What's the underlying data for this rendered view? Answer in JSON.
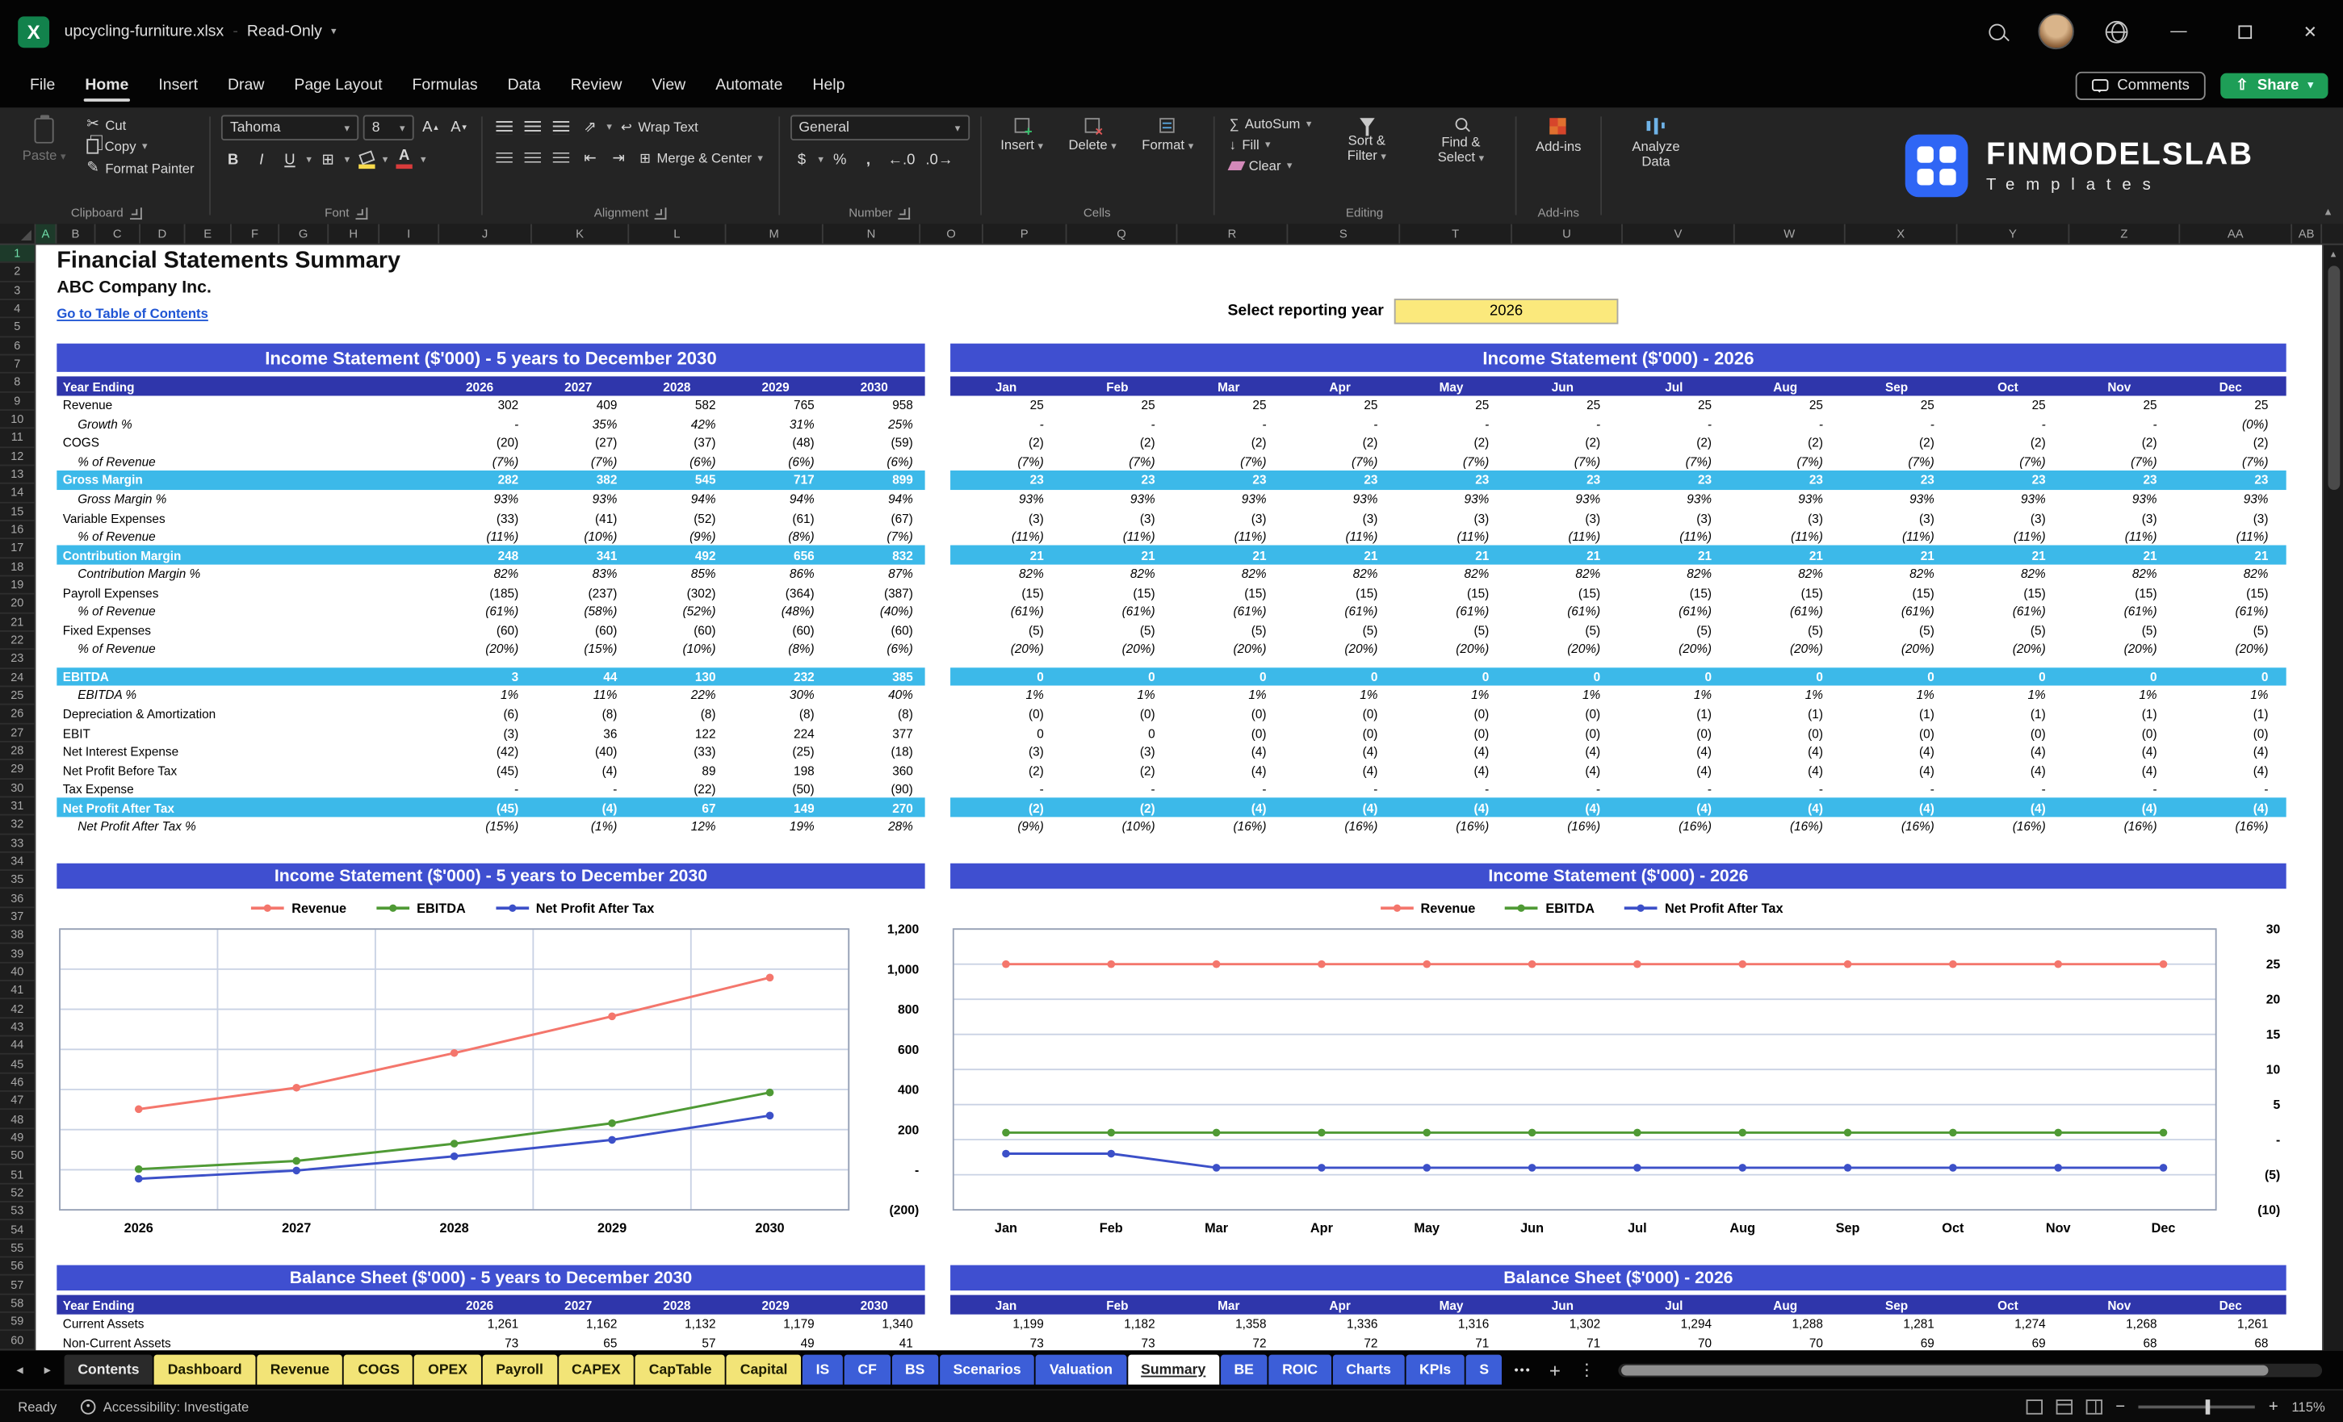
{
  "colors": {
    "header_blue": "#3F4FD0",
    "subheader_blue": "#2F36AB",
    "band_cyan": "#3CB9E9",
    "highlight_yellow": "#FBE97C",
    "tab_yellow": "#F2E477",
    "tab_blue": "#3C5ED8",
    "excel_green": "#12824C",
    "share_green": "#1E9E57",
    "link_blue": "#1F55D4",
    "fill_swatch": "#F7D94C",
    "font_swatch": "#D83B3B"
  },
  "titlebar": {
    "filename": "upcycling-furniture.xlsx",
    "separator": "-",
    "mode": "Read-Only"
  },
  "menu": {
    "items": [
      "File",
      "Home",
      "Insert",
      "Draw",
      "Page Layout",
      "Formulas",
      "Data",
      "Review",
      "View",
      "Automate",
      "Help"
    ],
    "active": "Home",
    "comments_label": "Comments",
    "share_label": "Share"
  },
  "ribbon": {
    "paste": "Paste",
    "cut": "Cut",
    "copy": "Copy",
    "format_painter": "Format Painter",
    "font_name": "Tahoma",
    "font_size": "8",
    "wrap_text": "Wrap Text",
    "merge_center": "Merge & Center",
    "number_format": "General",
    "insert": "Insert",
    "delete": "Delete",
    "format": "Format",
    "autosum": "AutoSum",
    "fill": "Fill",
    "clear": "Clear",
    "sort_filter": "Sort & Filter",
    "find_select": "Find & Select",
    "addins": "Add-ins",
    "analyze_data": "Analyze Data",
    "groups": {
      "clipboard": "Clipboard",
      "font": "Font",
      "alignment": "Alignment",
      "number": "Number",
      "cells": "Cells",
      "editing": "Editing",
      "addins": "Add-ins"
    }
  },
  "brand": {
    "name": "FINMODELSLAB",
    "tagline": "Templates"
  },
  "grid": {
    "row_count": 60,
    "columns": [
      {
        "l": "A",
        "w": 14
      },
      {
        "l": "B",
        "w": 26
      },
      {
        "l": "C",
        "w": 30
      },
      {
        "l": "D",
        "w": 30
      },
      {
        "l": "E",
        "w": 31
      },
      {
        "l": "F",
        "w": 32
      },
      {
        "l": "G",
        "w": 33
      },
      {
        "l": "H",
        "w": 34
      },
      {
        "l": "I",
        "w": 40
      },
      {
        "l": "J",
        "w": 62
      },
      {
        "l": "K",
        "w": 65
      },
      {
        "l": "L",
        "w": 65
      },
      {
        "l": "M",
        "w": 65
      },
      {
        "l": "N",
        "w": 65
      },
      {
        "l": "O",
        "w": 42
      },
      {
        "l": "P",
        "w": 56
      },
      {
        "l": "Q",
        "w": 74
      },
      {
        "l": "R",
        "w": 74
      },
      {
        "l": "S",
        "w": 75
      },
      {
        "l": "T",
        "w": 75
      },
      {
        "l": "U",
        "w": 74
      },
      {
        "l": "V",
        "w": 75
      },
      {
        "l": "W",
        "w": 74
      },
      {
        "l": "X",
        "w": 75
      },
      {
        "l": "Y",
        "w": 75
      },
      {
        "l": "Z",
        "w": 74
      },
      {
        "l": "AA",
        "w": 75
      },
      {
        "l": "AB",
        "w": 20
      }
    ]
  },
  "sheet": {
    "title": "Financial Statements Summary",
    "company": "ABC Company Inc.",
    "toc_link": "Go to Table of Contents",
    "reporting_label": "Select reporting year",
    "reporting_year": "2026",
    "year_ending_label": "Year Ending",
    "years": [
      "2026",
      "2027",
      "2028",
      "2029",
      "2030"
    ],
    "months": [
      "Jan",
      "Feb",
      "Mar",
      "Apr",
      "May",
      "Jun",
      "Jul",
      "Aug",
      "Sep",
      "Oct",
      "Nov",
      "Dec"
    ],
    "sections": {
      "is_left": "Income Statement ($'000) - 5 years to December 2030",
      "is_right": "Income Statement ($'000) - 2026",
      "bs_left": "Balance Sheet ($'000) - 5 years to December 2030",
      "bs_right": "Balance Sheet ($'000) - 2026"
    }
  },
  "is_table": {
    "rows": [
      {
        "label": "Revenue",
        "type": "plain",
        "y": [
          "302",
          "409",
          "582",
          "765",
          "958"
        ],
        "m": [
          "25",
          "25",
          "25",
          "25",
          "25",
          "25",
          "25",
          "25",
          "25",
          "25",
          "25",
          "25"
        ]
      },
      {
        "label": "Growth %",
        "type": "pct",
        "y": [
          "-",
          "35%",
          "42%",
          "31%",
          "25%"
        ],
        "m": [
          "-",
          "-",
          "-",
          "-",
          "-",
          "-",
          "-",
          "-",
          "-",
          "-",
          "-",
          "(0%)"
        ]
      },
      {
        "label": "COGS",
        "type": "plain",
        "y": [
          "(20)",
          "(27)",
          "(37)",
          "(48)",
          "(59)"
        ],
        "m": [
          "(2)",
          "(2)",
          "(2)",
          "(2)",
          "(2)",
          "(2)",
          "(2)",
          "(2)",
          "(2)",
          "(2)",
          "(2)",
          "(2)"
        ]
      },
      {
        "label": "% of Revenue",
        "type": "pct",
        "y": [
          "(7%)",
          "(7%)",
          "(6%)",
          "(6%)",
          "(6%)"
        ],
        "m": [
          "(7%)",
          "(7%)",
          "(7%)",
          "(7%)",
          "(7%)",
          "(7%)",
          "(7%)",
          "(7%)",
          "(7%)",
          "(7%)",
          "(7%)",
          "(7%)"
        ]
      },
      {
        "label": "Gross Margin",
        "type": "band",
        "y": [
          "282",
          "382",
          "545",
          "717",
          "899"
        ],
        "m": [
          "23",
          "23",
          "23",
          "23",
          "23",
          "23",
          "23",
          "23",
          "23",
          "23",
          "23",
          "23"
        ]
      },
      {
        "label": "Gross Margin %",
        "type": "pct",
        "y": [
          "93%",
          "93%",
          "94%",
          "94%",
          "94%"
        ],
        "m": [
          "93%",
          "93%",
          "93%",
          "93%",
          "93%",
          "93%",
          "93%",
          "93%",
          "93%",
          "93%",
          "93%",
          "93%"
        ]
      },
      {
        "label": "Variable Expenses",
        "type": "plain",
        "y": [
          "(33)",
          "(41)",
          "(52)",
          "(61)",
          "(67)"
        ],
        "m": [
          "(3)",
          "(3)",
          "(3)",
          "(3)",
          "(3)",
          "(3)",
          "(3)",
          "(3)",
          "(3)",
          "(3)",
          "(3)",
          "(3)"
        ]
      },
      {
        "label": "% of Revenue",
        "type": "pct",
        "y": [
          "(11%)",
          "(10%)",
          "(9%)",
          "(8%)",
          "(7%)"
        ],
        "m": [
          "(11%)",
          "(11%)",
          "(11%)",
          "(11%)",
          "(11%)",
          "(11%)",
          "(11%)",
          "(11%)",
          "(11%)",
          "(11%)",
          "(11%)",
          "(11%)"
        ]
      },
      {
        "label": "Contribution Margin",
        "type": "band",
        "y": [
          "248",
          "341",
          "492",
          "656",
          "832"
        ],
        "m": [
          "21",
          "21",
          "21",
          "21",
          "21",
          "21",
          "21",
          "21",
          "21",
          "21",
          "21",
          "21"
        ]
      },
      {
        "label": "Contribution Margin %",
        "type": "pct",
        "y": [
          "82%",
          "83%",
          "85%",
          "86%",
          "87%"
        ],
        "m": [
          "82%",
          "82%",
          "82%",
          "82%",
          "82%",
          "82%",
          "82%",
          "82%",
          "82%",
          "82%",
          "82%",
          "82%"
        ]
      },
      {
        "label": "Payroll Expenses",
        "type": "plain",
        "y": [
          "(185)",
          "(237)",
          "(302)",
          "(364)",
          "(387)"
        ],
        "m": [
          "(15)",
          "(15)",
          "(15)",
          "(15)",
          "(15)",
          "(15)",
          "(15)",
          "(15)",
          "(15)",
          "(15)",
          "(15)",
          "(15)"
        ]
      },
      {
        "label": "% of Revenue",
        "type": "pct",
        "y": [
          "(61%)",
          "(58%)",
          "(52%)",
          "(48%)",
          "(40%)"
        ],
        "m": [
          "(61%)",
          "(61%)",
          "(61%)",
          "(61%)",
          "(61%)",
          "(61%)",
          "(61%)",
          "(61%)",
          "(61%)",
          "(61%)",
          "(61%)",
          "(61%)"
        ]
      },
      {
        "label": "Fixed Expenses",
        "type": "plain",
        "y": [
          "(60)",
          "(60)",
          "(60)",
          "(60)",
          "(60)"
        ],
        "m": [
          "(5)",
          "(5)",
          "(5)",
          "(5)",
          "(5)",
          "(5)",
          "(5)",
          "(5)",
          "(5)",
          "(5)",
          "(5)",
          "(5)"
        ]
      },
      {
        "label": "% of Revenue",
        "type": "pct",
        "y": [
          "(20%)",
          "(15%)",
          "(10%)",
          "(8%)",
          "(6%)"
        ],
        "m": [
          "(20%)",
          "(20%)",
          "(20%)",
          "(20%)",
          "(20%)",
          "(20%)",
          "(20%)",
          "(20%)",
          "(20%)",
          "(20%)",
          "(20%)",
          "(20%)"
        ]
      },
      {
        "label": "",
        "type": "spacer",
        "y": [],
        "m": []
      },
      {
        "label": "EBITDA",
        "type": "band",
        "y": [
          "3",
          "44",
          "130",
          "232",
          "385"
        ],
        "m": [
          "0",
          "0",
          "0",
          "0",
          "0",
          "0",
          "0",
          "0",
          "0",
          "0",
          "0",
          "0"
        ]
      },
      {
        "label": "EBITDA %",
        "type": "pct",
        "y": [
          "1%",
          "11%",
          "22%",
          "30%",
          "40%"
        ],
        "m": [
          "1%",
          "1%",
          "1%",
          "1%",
          "1%",
          "1%",
          "1%",
          "1%",
          "1%",
          "1%",
          "1%",
          "1%"
        ]
      },
      {
        "label": "Depreciation & Amortization",
        "type": "plain",
        "y": [
          "(6)",
          "(8)",
          "(8)",
          "(8)",
          "(8)"
        ],
        "m": [
          "(0)",
          "(0)",
          "(0)",
          "(0)",
          "(0)",
          "(0)",
          "(1)",
          "(1)",
          "(1)",
          "(1)",
          "(1)",
          "(1)"
        ]
      },
      {
        "label": "EBIT",
        "type": "plain",
        "y": [
          "(3)",
          "36",
          "122",
          "224",
          "377"
        ],
        "m": [
          "0",
          "0",
          "(0)",
          "(0)",
          "(0)",
          "(0)",
          "(0)",
          "(0)",
          "(0)",
          "(0)",
          "(0)",
          "(0)"
        ]
      },
      {
        "label": "Net Interest Expense",
        "type": "plain",
        "y": [
          "(42)",
          "(40)",
          "(33)",
          "(25)",
          "(18)"
        ],
        "m": [
          "(3)",
          "(3)",
          "(4)",
          "(4)",
          "(4)",
          "(4)",
          "(4)",
          "(4)",
          "(4)",
          "(4)",
          "(4)",
          "(4)"
        ]
      },
      {
        "label": "Net Profit Before Tax",
        "type": "plain",
        "y": [
          "(45)",
          "(4)",
          "89",
          "198",
          "360"
        ],
        "m": [
          "(2)",
          "(2)",
          "(4)",
          "(4)",
          "(4)",
          "(4)",
          "(4)",
          "(4)",
          "(4)",
          "(4)",
          "(4)",
          "(4)"
        ]
      },
      {
        "label": "Tax Expense",
        "type": "plain",
        "y": [
          "-",
          "-",
          "(22)",
          "(50)",
          "(90)"
        ],
        "m": [
          "-",
          "-",
          "-",
          "-",
          "-",
          "-",
          "-",
          "-",
          "-",
          "-",
          "-",
          "-"
        ]
      },
      {
        "label": "Net Profit After Tax",
        "type": "band",
        "y": [
          "(45)",
          "(4)",
          "67",
          "149",
          "270"
        ],
        "m": [
          "(2)",
          "(2)",
          "(4)",
          "(4)",
          "(4)",
          "(4)",
          "(4)",
          "(4)",
          "(4)",
          "(4)",
          "(4)",
          "(4)"
        ]
      },
      {
        "label": "Net Profit After Tax %",
        "type": "pct",
        "y": [
          "(15%)",
          "(1%)",
          "12%",
          "19%",
          "28%"
        ],
        "m": [
          "(9%)",
          "(10%)",
          "(16%)",
          "(16%)",
          "(16%)",
          "(16%)",
          "(16%)",
          "(16%)",
          "(16%)",
          "(16%)",
          "(16%)",
          "(16%)"
        ]
      }
    ]
  },
  "bs_table": {
    "rows": [
      {
        "label": "Current Assets",
        "type": "plain",
        "y": [
          "1,261",
          "1,162",
          "1,132",
          "1,179",
          "1,340"
        ],
        "m": [
          "1,199",
          "1,182",
          "1,358",
          "1,336",
          "1,316",
          "1,302",
          "1,294",
          "1,288",
          "1,281",
          "1,274",
          "1,268",
          "1,261"
        ]
      },
      {
        "label": "Non-Current Assets",
        "type": "plain",
        "y": [
          "73",
          "65",
          "57",
          "49",
          "41"
        ],
        "m": [
          "73",
          "73",
          "72",
          "72",
          "71",
          "71",
          "70",
          "70",
          "69",
          "69",
          "68",
          "68"
        ]
      }
    ]
  },
  "chart_data": [
    {
      "type": "line",
      "title": "Income Statement ($'000) - 5 years to December 2030",
      "categories": [
        "2026",
        "2027",
        "2028",
        "2029",
        "2030"
      ],
      "series": [
        {
          "name": "Revenue",
          "color": "#F4766C",
          "values": [
            302,
            409,
            582,
            765,
            958
          ]
        },
        {
          "name": "EBITDA",
          "color": "#4F9A35",
          "values": [
            3,
            44,
            130,
            232,
            385
          ]
        },
        {
          "name": "Net Profit After Tax",
          "color": "#3C50C8",
          "values": [
            -45,
            -4,
            67,
            149,
            270
          ]
        }
      ],
      "ylim": [
        -200,
        1200
      ],
      "yticks": [
        {
          "v": 1200,
          "l": "1,200"
        },
        {
          "v": 1000,
          "l": "1,000"
        },
        {
          "v": 800,
          "l": "800"
        },
        {
          "v": 600,
          "l": "600"
        },
        {
          "v": 400,
          "l": "400"
        },
        {
          "v": 200,
          "l": "200"
        },
        {
          "v": 0,
          "l": "-"
        },
        {
          "v": -200,
          "l": "(200)"
        }
      ],
      "vgrid": 5,
      "grid": true,
      "legend_position": "top"
    },
    {
      "type": "line",
      "title": "Income Statement ($'000) - 2026",
      "categories": [
        "Jan",
        "Feb",
        "Mar",
        "Apr",
        "May",
        "Jun",
        "Jul",
        "Aug",
        "Sep",
        "Oct",
        "Nov",
        "Dec"
      ],
      "series": [
        {
          "name": "Revenue",
          "color": "#F4766C",
          "values": [
            25,
            25,
            25,
            25,
            25,
            25,
            25,
            25,
            25,
            25,
            25,
            25
          ]
        },
        {
          "name": "EBITDA",
          "color": "#4F9A35",
          "values": [
            1,
            1,
            1,
            1,
            1,
            1,
            1,
            1,
            1,
            1,
            1,
            1
          ]
        },
        {
          "name": "Net Profit After Tax",
          "color": "#3C50C8",
          "values": [
            -2,
            -2,
            -4,
            -4,
            -4,
            -4,
            -4,
            -4,
            -4,
            -4,
            -4,
            -4
          ]
        }
      ],
      "ylim": [
        -10,
        30
      ],
      "yticks": [
        {
          "v": 30,
          "l": "30"
        },
        {
          "v": 25,
          "l": "25"
        },
        {
          "v": 20,
          "l": "20"
        },
        {
          "v": 15,
          "l": "15"
        },
        {
          "v": 10,
          "l": "10"
        },
        {
          "v": 5,
          "l": "5"
        },
        {
          "v": 0,
          "l": "-"
        },
        {
          "v": -5,
          "l": "(5)"
        },
        {
          "v": -10,
          "l": "(10)"
        }
      ],
      "vgrid": 0,
      "grid": true,
      "legend_position": "top"
    }
  ],
  "tabs": [
    {
      "label": "Contents",
      "color": "dark"
    },
    {
      "label": "Dashboard",
      "color": "yellow"
    },
    {
      "label": "Revenue",
      "color": "yellow"
    },
    {
      "label": "COGS",
      "color": "yellow"
    },
    {
      "label": "OPEX",
      "color": "yellow"
    },
    {
      "label": "Payroll",
      "color": "yellow"
    },
    {
      "label": "CAPEX",
      "color": "yellow"
    },
    {
      "label": "CapTable",
      "color": "yellow"
    },
    {
      "label": "Capital",
      "color": "yellow"
    },
    {
      "label": "IS",
      "color": "blue"
    },
    {
      "label": "CF",
      "color": "blue"
    },
    {
      "label": "BS",
      "color": "blue"
    },
    {
      "label": "Scenarios",
      "color": "blue"
    },
    {
      "label": "Valuation",
      "color": "blue"
    },
    {
      "label": "Summary",
      "color": "active"
    },
    {
      "label": "BE",
      "color": "blue"
    },
    {
      "label": "ROIC",
      "color": "blue"
    },
    {
      "label": "Charts",
      "color": "blue"
    },
    {
      "label": "KPIs",
      "color": "blue"
    },
    {
      "label": "S",
      "color": "blue"
    }
  ],
  "statusbar": {
    "ready": "Ready",
    "accessibility": "Accessibility: Investigate",
    "zoom": "115%"
  }
}
